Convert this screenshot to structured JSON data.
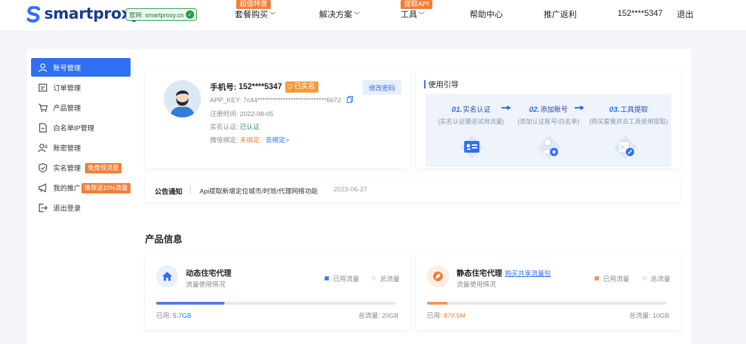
{
  "colors": {
    "primary": "#2f6ff2",
    "accent_orange": "#f37d36",
    "green": "#2b9a4a"
  },
  "header": {
    "brand": "smartproxy",
    "official_label": "官网: smartproxy.cn",
    "nav": [
      {
        "label": "套餐购买",
        "tag": "超值特惠",
        "has_dropdown": true
      },
      {
        "label": "解决方案",
        "has_dropdown": true
      },
      {
        "label": "工具",
        "tag": "提取API",
        "has_dropdown": true
      },
      {
        "label": "帮助中心"
      },
      {
        "label": "推广返利"
      },
      {
        "label": "152****5347"
      },
      {
        "label": "退出"
      }
    ]
  },
  "sidebar": {
    "items": [
      {
        "label": "账号管理",
        "icon": "user-icon",
        "active": true
      },
      {
        "label": "订单管理",
        "icon": "order-icon"
      },
      {
        "label": "产品管理",
        "icon": "cart-icon"
      },
      {
        "label": "白名单IP管理",
        "icon": "document-icon"
      },
      {
        "label": "账密管理",
        "icon": "user-key-icon"
      },
      {
        "label": "实名管理",
        "icon": "shield-check-icon",
        "badge": "免费领流量"
      },
      {
        "label": "我的推广",
        "icon": "megaphone-icon",
        "badge": "推荐送10%流量"
      },
      {
        "label": "退出登录",
        "icon": "logout-icon"
      }
    ]
  },
  "account": {
    "phone_label": "手机号:",
    "phone": "152****5347",
    "verified_badge": "已实名",
    "change_password": "修改密码",
    "app_key_label": "APP_KEY:",
    "app_key": "7c44***************************6672",
    "register_label": "注册时间:",
    "register_date": "2022-08-05",
    "realname_label": "实名认证:",
    "realname_status": "已认证",
    "wechat_label": "微信绑定:",
    "wechat_status": "未绑定",
    "wechat_action": "去绑定>"
  },
  "guide": {
    "title": "使用引导",
    "steps": [
      {
        "num": "01.",
        "title": "实名认证",
        "sub": "(实名认证赠送试用流量)"
      },
      {
        "num": "02.",
        "title": "添加账号",
        "sub": "(添加认证账号/白名单)"
      },
      {
        "num": "03.",
        "title": "工具提取",
        "sub": "(购买套餐并去工具使用提取)"
      }
    ]
  },
  "notice": {
    "label": "公告通知",
    "text": "Api提取新增定位城市/时效/代理网络功能",
    "date": "2023-06-27"
  },
  "products_title": "产品信息",
  "products": [
    {
      "name": "动态住宅代理",
      "link": "",
      "sub": "流量使用情况",
      "legend_used": "已用流量",
      "legend_total": "总流量",
      "used_label": "已用: ",
      "used_value": "5.7GB",
      "total_label": "总流量: ",
      "total_value": "20GB",
      "usage_ratio": 0.285,
      "color": "#4a7cf0",
      "icon": "home-icon"
    },
    {
      "name": "静态住宅代理",
      "link": "购买共享流量包",
      "sub": "流量使用情况",
      "legend_used": "已用流量",
      "legend_total": "总流量",
      "used_label": "已用: ",
      "used_value": "879.5M",
      "total_label": "总流量: ",
      "total_value": "10GB",
      "usage_ratio": 0.086,
      "color": "#f5935a",
      "icon": "leaf-icon"
    }
  ]
}
